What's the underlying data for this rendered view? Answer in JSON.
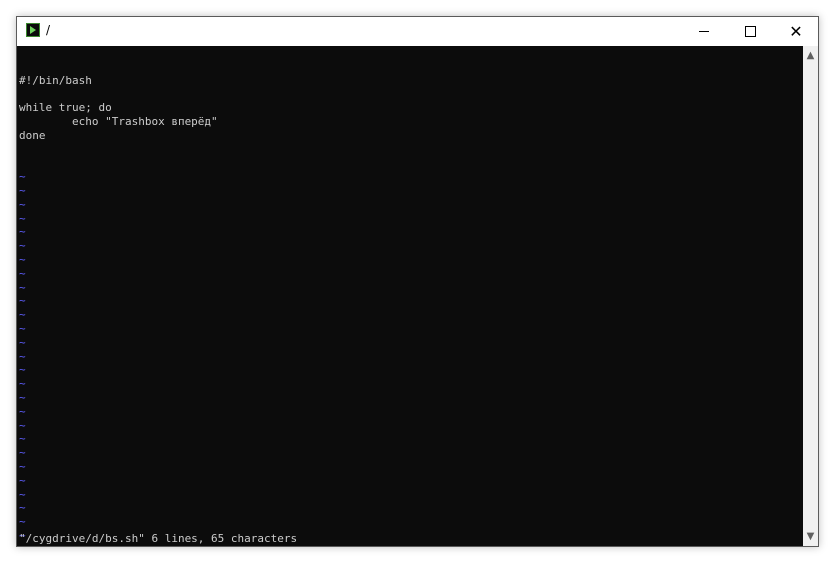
{
  "window": {
    "title": "/",
    "minimize_glyph": "–",
    "close_glyph": "✕"
  },
  "editor": {
    "lines": [
      "#!/bin/bash",
      "",
      "while true; do",
      "        echo \"Trashbox вперёд\"",
      "done"
    ],
    "empty_line_marker": "~",
    "empty_line_count": 28,
    "status_line": "\"/cygdrive/d/bs.sh\" 6 lines, 65 characters"
  },
  "scrollbar": {
    "up_glyph": "▲",
    "down_glyph": "▼"
  },
  "colors": {
    "background": "#0c0c0c",
    "text": "#cccccc",
    "tilde": "#5f5fff"
  },
  "icons": {
    "app": "cygwin-terminal-icon",
    "minimize": "minimize-icon",
    "maximize": "maximize-icon",
    "close": "close-icon"
  }
}
